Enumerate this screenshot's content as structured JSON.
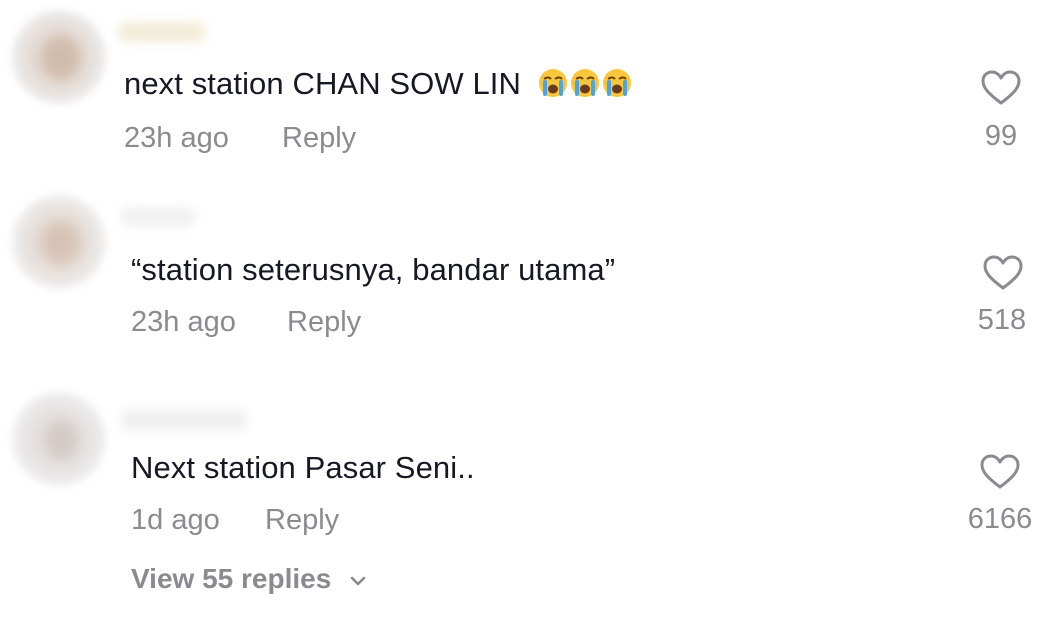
{
  "comments": [
    {
      "text": "next station CHAN SOW LIN",
      "emojis": [
        "loudly-crying-face",
        "loudly-crying-face",
        "loudly-crying-face"
      ],
      "time": "23h ago",
      "reply_label": "Reply",
      "likes": "99"
    },
    {
      "text": "“station seterusnya, bandar utama”",
      "time": "23h ago",
      "reply_label": "Reply",
      "likes": "518"
    },
    {
      "text": "Next station Pasar Seni..",
      "time": "1d ago",
      "reply_label": "Reply",
      "likes": "6166",
      "view_replies_label": "View 55 replies"
    }
  ],
  "colors": {
    "text": "#161823",
    "muted": "#8a8b91",
    "background": "#ffffff"
  }
}
